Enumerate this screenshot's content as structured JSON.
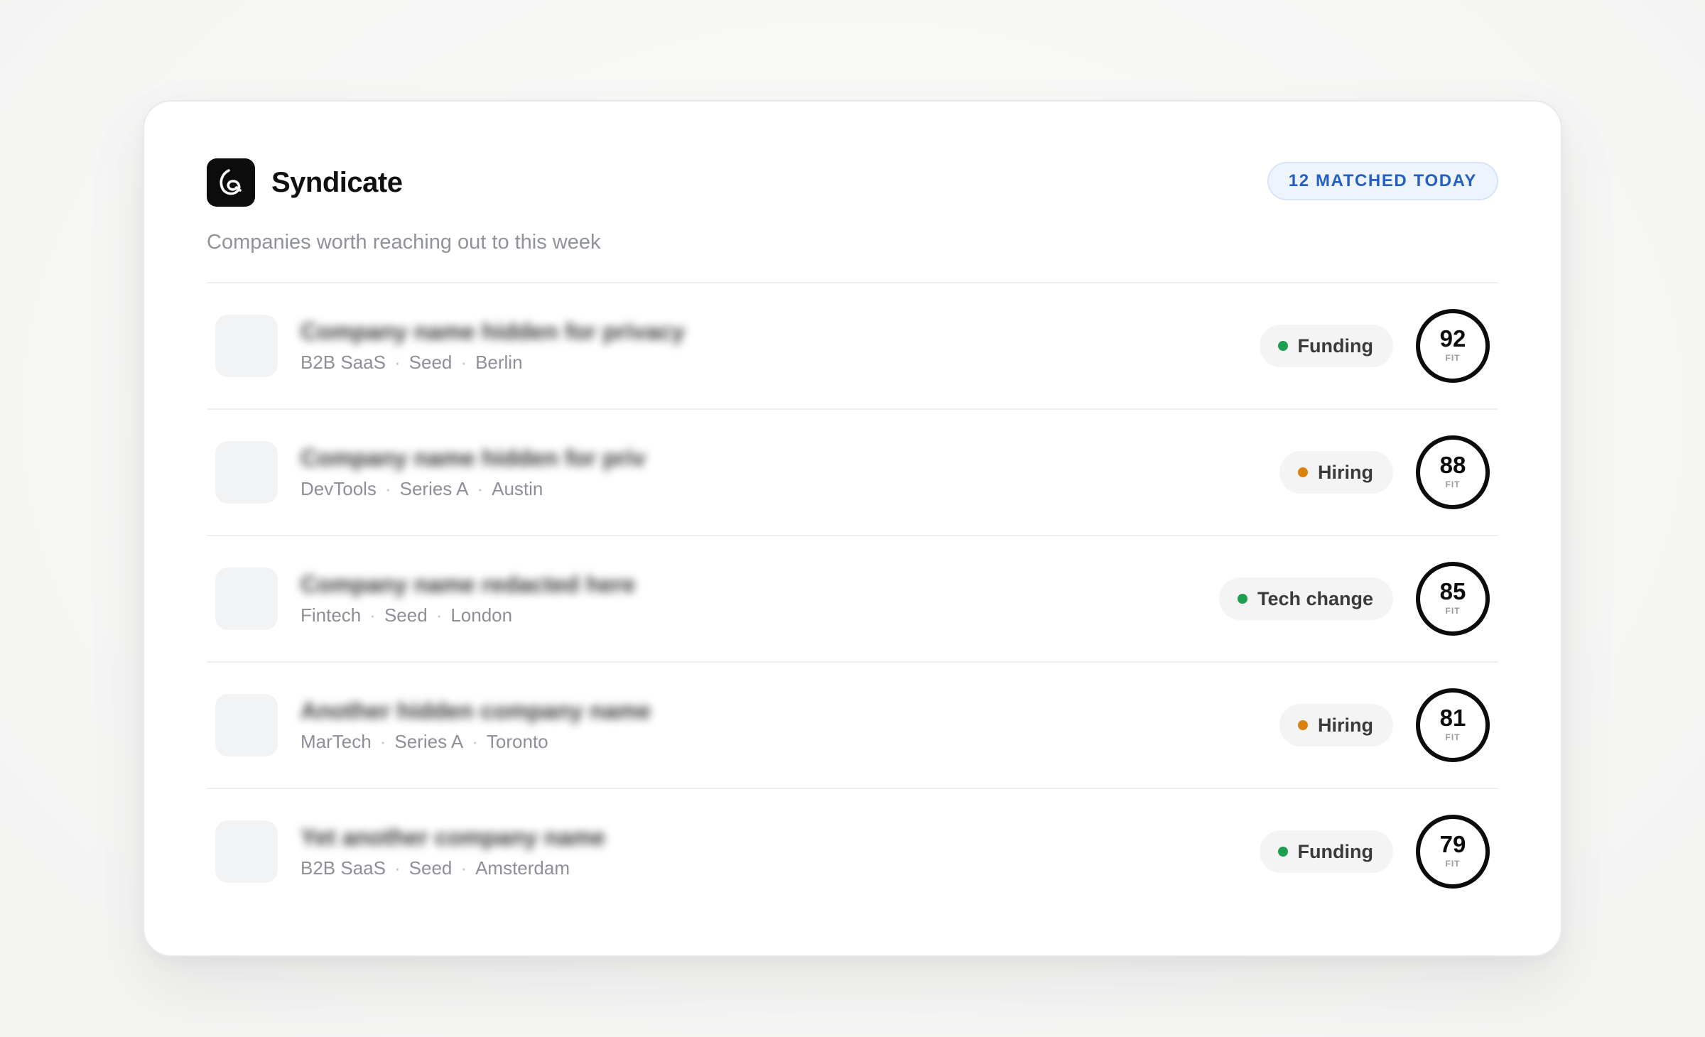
{
  "app": {
    "name": "Syndicate",
    "subtitle": "Companies worth reaching out to this week",
    "matched_badge": "12 MATCHED TODAY",
    "logo_icon": "spiral-logo-icon"
  },
  "colors": {
    "accent_blue": "#2460c4",
    "signal_green": "#1e9e4f",
    "signal_orange": "#d9820e"
  },
  "score_unit": "FIT",
  "companies": [
    {
      "name": "Company name hidden for privacy",
      "sector": "B2B SaaS",
      "stage": "Seed",
      "city": "Berlin",
      "signal": "Funding",
      "signal_color": "#1e9e4f",
      "score": "92"
    },
    {
      "name": "Company name hidden for priv",
      "sector": "DevTools",
      "stage": "Series A",
      "city": "Austin",
      "signal": "Hiring",
      "signal_color": "#d9820e",
      "score": "88"
    },
    {
      "name": "Company name redacted here",
      "sector": "Fintech",
      "stage": "Seed",
      "city": "London",
      "signal": "Tech change",
      "signal_color": "#1e9e4f",
      "score": "85"
    },
    {
      "name": "Another hidden company name",
      "sector": "MarTech",
      "stage": "Series A",
      "city": "Toronto",
      "signal": "Hiring",
      "signal_color": "#d9820e",
      "score": "81"
    },
    {
      "name": "Yet another company name",
      "sector": "B2B SaaS",
      "stage": "Seed",
      "city": "Amsterdam",
      "signal": "Funding",
      "signal_color": "#1e9e4f",
      "score": "79"
    }
  ]
}
